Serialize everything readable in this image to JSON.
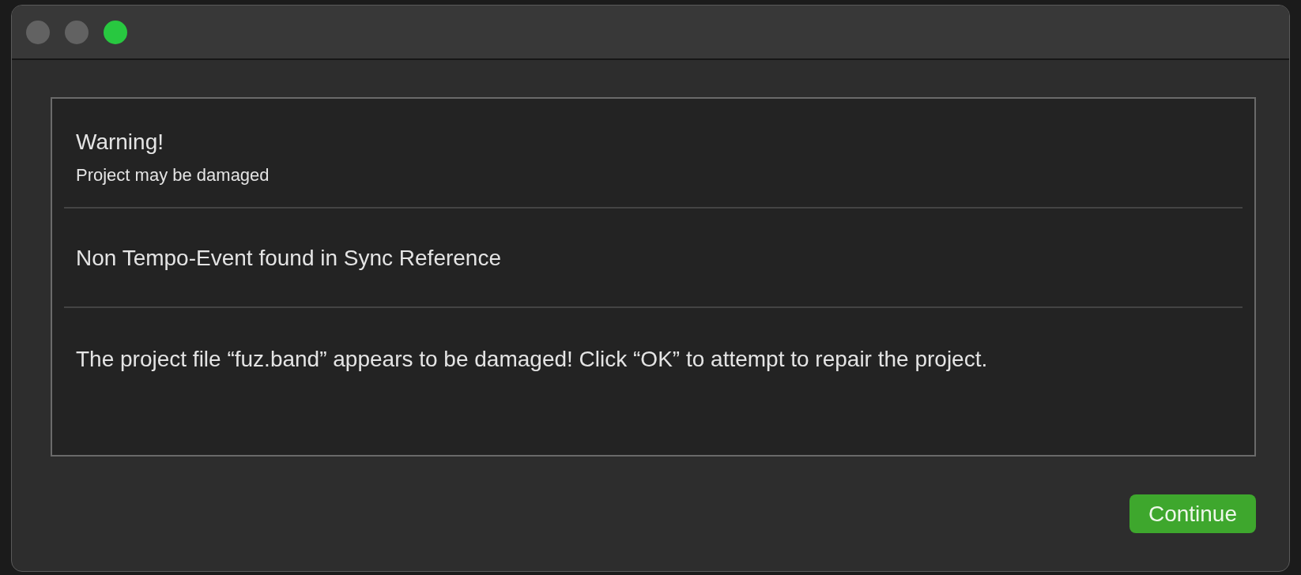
{
  "window_controls": [
    {
      "color": "#626262"
    },
    {
      "color": "#626262"
    },
    {
      "color": "#28c840"
    }
  ],
  "alert": {
    "title": "Warning!",
    "subtitle": "Project may be damaged",
    "sections": [
      {
        "text": "Non Tempo-Event found in Sync Reference"
      },
      {
        "text": "The project file “fuz.band” appears to be damaged! Click “OK” to attempt to repair the project."
      }
    ]
  },
  "buttons": [
    {
      "label": "Continue",
      "kind": "primary"
    }
  ]
}
